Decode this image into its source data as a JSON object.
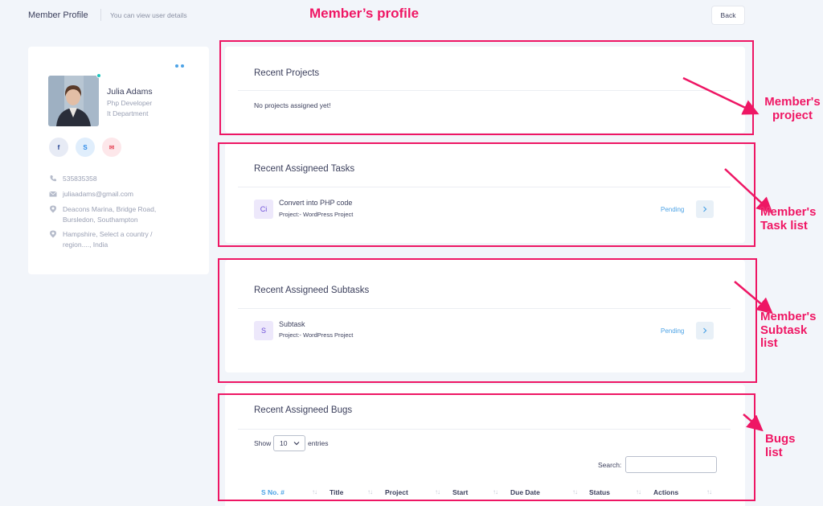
{
  "header": {
    "title": "Member Profile",
    "subtitle": "You can view user details",
    "back_label": "Back"
  },
  "annotations": {
    "title": "Member’s profile",
    "project": "Member's project",
    "task": "Member's Task list",
    "subtask": "Member's Subtask list",
    "bugs": "Bugs list",
    "color": "#ee1664"
  },
  "profile": {
    "name": "Julia Adams",
    "role": "Php Developer",
    "department": "It Department",
    "social": [
      {
        "icon": "facebook-icon",
        "glyph": "f"
      },
      {
        "icon": "skype-icon",
        "glyph": "S"
      },
      {
        "icon": "mail-icon",
        "glyph": "✉"
      }
    ],
    "phone": "535835358",
    "email": "juliaadams@gmail.com",
    "address": "Deacons Marina, Bridge Road, Bursledon, Southampton",
    "region": "Hampshire, Select a country / region...., India"
  },
  "projects": {
    "title": "Recent Projects",
    "empty": "No projects assigned yet!"
  },
  "tasks": {
    "title": "Recent Assigneed Tasks",
    "items": [
      {
        "badge": "Ci",
        "name": "Convert into PHP code",
        "project": "Project:- WordPress Project",
        "status": "Pending"
      }
    ]
  },
  "subtasks": {
    "title": "Recent Assigneed Subtasks",
    "items": [
      {
        "badge": "S",
        "name": "Subtask",
        "project": "Project:- WordPress Project",
        "status": "Pending"
      }
    ]
  },
  "bugs": {
    "title": "Recent Assigneed Bugs",
    "show_label": "Show",
    "entries_value": "10",
    "entries_label": "entries",
    "search_label": "Search:",
    "columns": [
      "S No. #",
      "Title",
      "Project",
      "Start",
      "Due Date",
      "Status",
      "Actions"
    ]
  },
  "colors": {
    "accent": "#4da3e6",
    "online": "#1bc5bd",
    "badge": "#6d4fd8"
  }
}
